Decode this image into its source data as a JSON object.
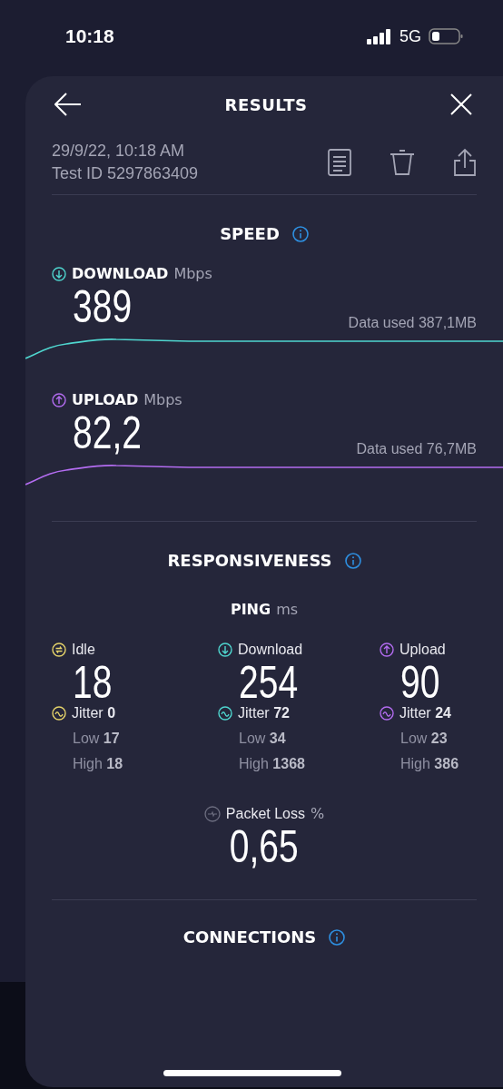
{
  "status_bar": {
    "time": "10:18",
    "network": "5G"
  },
  "header": {
    "title": "RESULTS"
  },
  "test": {
    "date": "29/9/22, 10:18 AM",
    "test_id": "Test ID 5297863409"
  },
  "speed": {
    "title": "SPEED",
    "metrics": [
      {
        "kind": "download",
        "label": "DOWNLOAD",
        "unit": "Mbps",
        "value": "389",
        "data_used": "Data used 387,1MB"
      },
      {
        "kind": "upload",
        "label": "UPLOAD",
        "unit": "Mbps",
        "value": "82,2",
        "data_used": "Data used 76,7MB"
      }
    ]
  },
  "responsiveness": {
    "title": "RESPONSIVENESS",
    "ping": {
      "label": "PING",
      "unit": "ms"
    },
    "columns": [
      {
        "kind": "idle",
        "label": "Idle",
        "value": "18",
        "jitter": "Jitter **0**",
        "low": "Low **17**",
        "high": "High **18**"
      },
      {
        "kind": "download",
        "label": "Download",
        "value": "254",
        "jitter": "Jitter **72**",
        "low": "Low **34**",
        "high": "High **1368**"
      },
      {
        "kind": "upload",
        "label": "Upload",
        "value": "90",
        "jitter": "Jitter **24**",
        "low": "Low **23**",
        "high": "High **386**"
      }
    ],
    "packet_loss": {
      "label": "Packet Loss",
      "unit": "%",
      "value": "0,65"
    }
  },
  "connections": {
    "title": "CONNECTIONS"
  }
}
